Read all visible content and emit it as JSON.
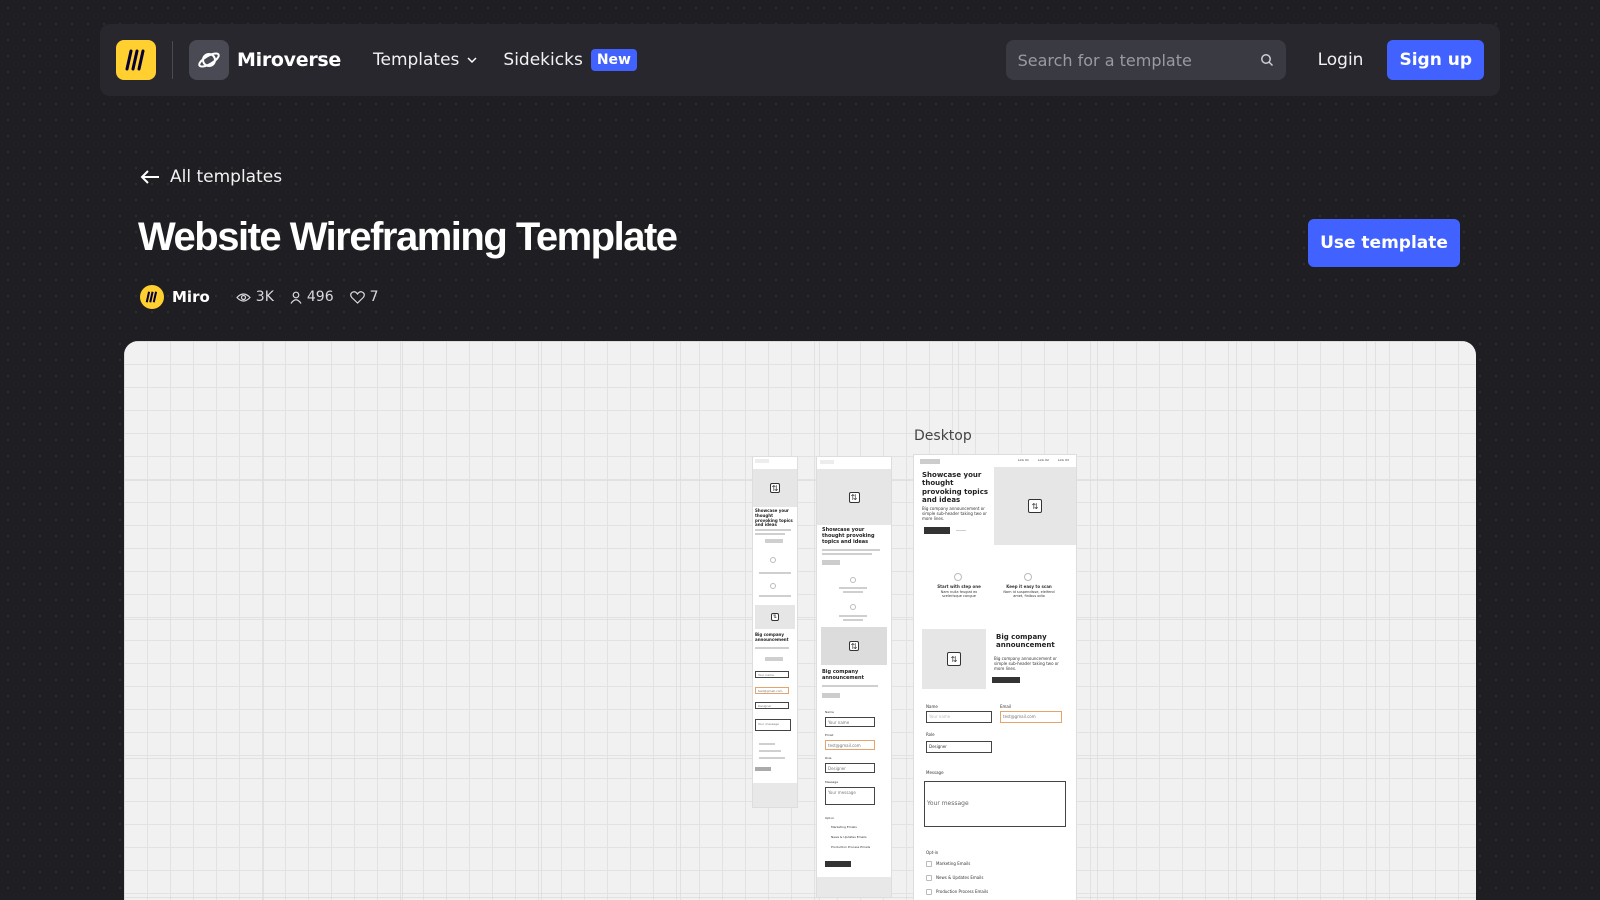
{
  "nav": {
    "brand": "Miroverse",
    "templates_label": "Templates",
    "sidekicks_label": "Sidekicks",
    "new_badge": "New",
    "search_placeholder": "Search for a template",
    "login_label": "Login",
    "signup_label": "Sign up"
  },
  "page": {
    "back_label": "All templates",
    "title": "Website Wireframing Template",
    "use_template_label": "Use template",
    "author": "Miro",
    "views": "3K",
    "users": "496",
    "likes": "7"
  },
  "preview": {
    "frame_label": "Desktop",
    "desktop": {
      "nav_links": [
        "Link 01",
        "Link 02",
        "Link 03"
      ],
      "hero_heading": "Showcase your thought provoking topics and ideas",
      "hero_sub": "Big company announcement or simple sub-header taking two or more lines.",
      "feature1_title": "Start with step one",
      "feature1_text": "Nam nulla feugiat ex scelerisque congue",
      "feature2_title": "Keep it easy to scan",
      "feature2_text": "Nam id suspendisse, eleifend amet, finibus odio",
      "announce_heading": "Big company announcement",
      "announce_sub": "Big company announcement or simple sub-header taking two or more lines.",
      "name_label": "Name",
      "name_placeholder": "Your name",
      "email_label": "Email",
      "email_value": "test@gmail.com",
      "role_label": "Role",
      "role_value": "Designer",
      "message_label": "Message",
      "message_placeholder": "Your message",
      "optin_label": "Opt-in",
      "optin_items": [
        "Marketing Emails",
        "News & Updates Emails",
        "Production Process Emails"
      ]
    },
    "tablet": {
      "hero_heading": "Showcase your thought provoking topics and ideas",
      "announce_heading": "Big company announcement",
      "name_label": "Name",
      "name_placeholder": "Your name",
      "email_label": "Email",
      "email_value": "test@gmail.com",
      "role_label": "Role",
      "role_value": "Designer",
      "message_label": "Message",
      "message_placeholder": "Your message",
      "optin_label": "Opt-in",
      "optin_items": [
        "Marketing Emails",
        "News & Updates Emails",
        "Production Process Emails"
      ]
    },
    "mobile": {
      "hero_heading": "Showcase your thought provoking topics and ideas",
      "announce_heading": "Big company announcement",
      "name_placeholder": "Your name",
      "email_value": "test@gmail.com",
      "role_value": "Designer",
      "message_placeholder": "Your message"
    }
  }
}
